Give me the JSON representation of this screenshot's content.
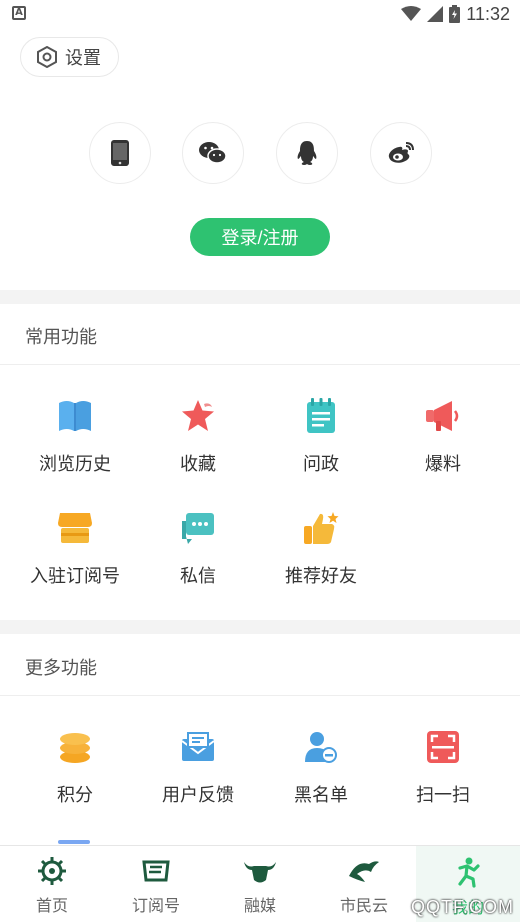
{
  "status_bar": {
    "time": "11:32",
    "left_badge": "A"
  },
  "settings": {
    "label": "设置"
  },
  "login": {
    "methods": [
      "phone-icon",
      "wechat-icon",
      "qq-icon",
      "weibo-icon"
    ],
    "button_label": "登录/注册",
    "accent": "#2ec271"
  },
  "common": {
    "title": "常用功能",
    "items": [
      {
        "label": "浏览历史",
        "icon": "book-icon"
      },
      {
        "label": "收藏",
        "icon": "star-icon"
      },
      {
        "label": "问政",
        "icon": "notepad-icon"
      },
      {
        "label": "爆料",
        "icon": "megaphone-icon"
      },
      {
        "label": "入驻订阅号",
        "icon": "shop-icon"
      },
      {
        "label": "私信",
        "icon": "message-icon"
      },
      {
        "label": "推荐好友",
        "icon": "thumbs-up-icon"
      }
    ]
  },
  "more": {
    "title": "更多功能",
    "items": [
      {
        "label": "积分",
        "icon": "coins-icon"
      },
      {
        "label": "用户反馈",
        "icon": "mail-icon"
      },
      {
        "label": "黑名单",
        "icon": "user-block-icon"
      },
      {
        "label": "扫一扫",
        "icon": "scan-icon"
      }
    ]
  },
  "tabbar": {
    "tabs": [
      {
        "label": "首页",
        "icon": "gear-sun-icon"
      },
      {
        "label": "订阅号",
        "icon": "ticket-icon"
      },
      {
        "label": "融媒",
        "icon": "bull-icon"
      },
      {
        "label": "市民云",
        "icon": "bird-icon"
      },
      {
        "label": "我的",
        "icon": "person-run-icon"
      }
    ],
    "active_index": 4
  },
  "watermark": "QQTF.COM"
}
